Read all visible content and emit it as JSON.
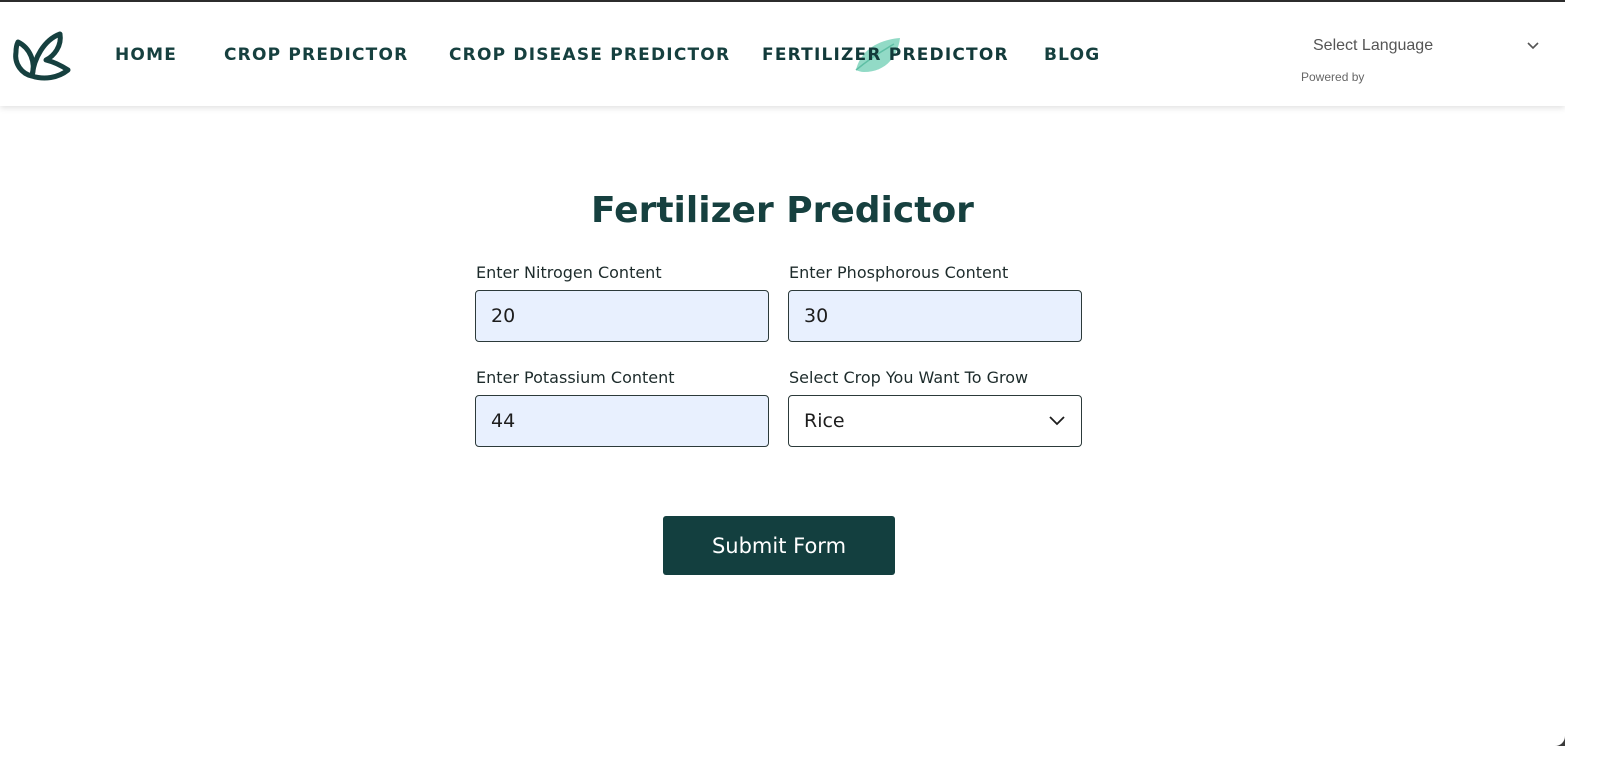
{
  "nav": {
    "items": [
      {
        "label": "HOME"
      },
      {
        "label": "CROP PREDICTOR"
      },
      {
        "label": "CROP DISEASE PREDICTOR"
      },
      {
        "label": "FERTILIZER PREDICTOR",
        "active": true
      },
      {
        "label": "BLOG"
      }
    ],
    "language": {
      "selected": "Select Language",
      "powered_by": "Powered by"
    }
  },
  "colors": {
    "brand_dark": "#133f3f",
    "input_bg": "#e8f0fe",
    "leaf_accent": "#7fd3bc"
  },
  "form": {
    "title": "Fertilizer Predictor",
    "nitrogen": {
      "label": "Enter Nitrogen Content",
      "value": "20"
    },
    "phosphorous": {
      "label": "Enter Phosphorous Content",
      "value": "30"
    },
    "potassium": {
      "label": "Enter Potassium Content",
      "value": "44"
    },
    "crop": {
      "label": "Select Crop You Want To Grow",
      "selected": "Rice"
    },
    "submit_label": "Submit Form"
  },
  "icons": {
    "logo": "leaf-logo-icon",
    "nav_active_marker": "leaf-icon",
    "dropdown": "chevron-down-icon"
  }
}
